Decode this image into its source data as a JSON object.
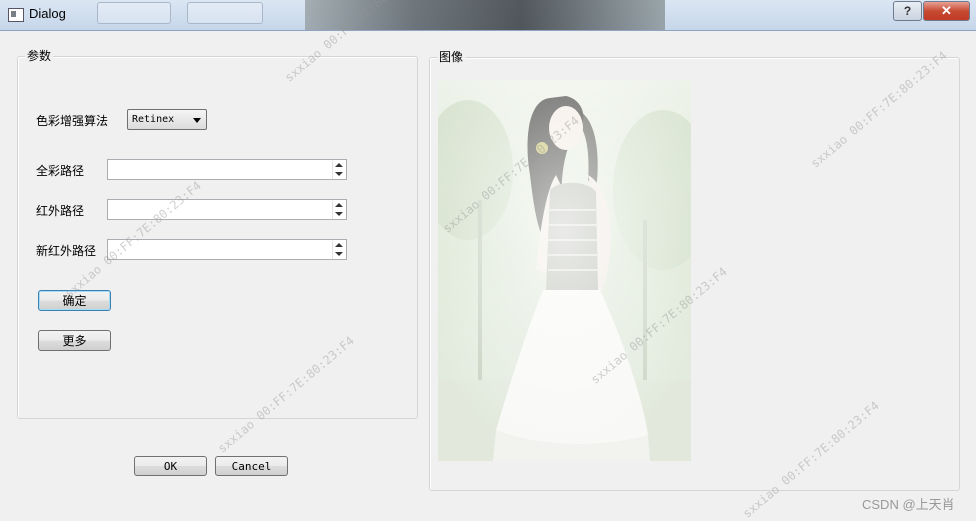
{
  "window": {
    "title": "Dialog",
    "help_label": "?",
    "close_label": "✕"
  },
  "params_group": {
    "title": "参数",
    "algorithm_label": "色彩增强算法",
    "algorithm_value": "Retinex",
    "fullcolor_label": "全彩路径",
    "fullcolor_value": "",
    "infrared_label": "红外路径",
    "infrared_value": "",
    "new_infrared_label": "新红外路径",
    "new_infrared_value": "",
    "confirm_label": "确定",
    "more_label": "更多"
  },
  "image_group": {
    "title": "图像"
  },
  "dialog_buttons": {
    "ok_label": "OK",
    "cancel_label": "Cancel"
  },
  "watermark": {
    "text": "sxxiao 00:FF:7E:80:23:F4"
  },
  "footer": {
    "credit": "CSDN @上天肖"
  }
}
